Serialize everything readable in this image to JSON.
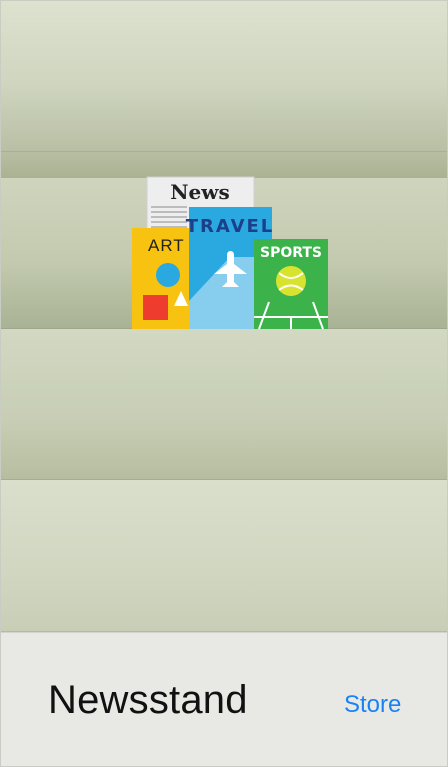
{
  "header": {
    "title": "Newsstand"
  },
  "toolbar": {
    "store_label": "Store"
  },
  "magazines": {
    "news_label": "News",
    "art_label": "ART",
    "travel_label": "TRAVEL",
    "sports_label": "SPORTS"
  },
  "colors": {
    "accent": "#1a82f5",
    "art_cover": "#f7c310",
    "travel_cover": "#2aa9e0",
    "sports_cover": "#3bb34a"
  },
  "icons": [
    "newspaper-icon",
    "art-magazine-icon",
    "travel-magazine-icon",
    "sports-magazine-icon",
    "airplane-icon",
    "tennis-ball-icon"
  ]
}
